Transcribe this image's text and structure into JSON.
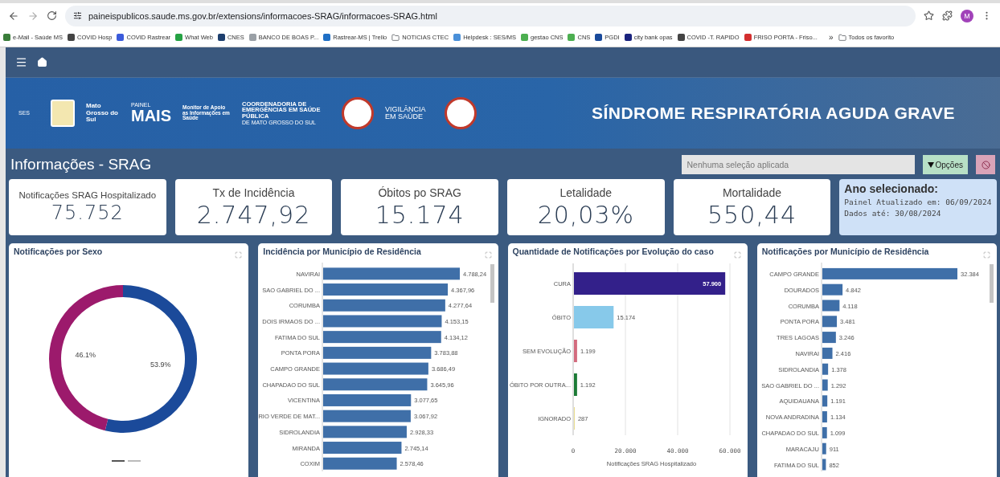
{
  "browser": {
    "url": "paineispublicos.saude.ms.gov.br/extensions/informacoes-SRAG/informacoes-SRAG.html",
    "avatar": "M",
    "bookmarks": [
      {
        "label": "e-Mail - Saúde MS",
        "kind": "site",
        "color": "#3a7d3a"
      },
      {
        "label": "COVID Hosp",
        "kind": "site",
        "color": "#444444"
      },
      {
        "label": "COVID Rastrear",
        "kind": "site",
        "color": "#3b5bdb"
      },
      {
        "label": "What Web",
        "kind": "site",
        "color": "#25a244"
      },
      {
        "label": "CNES",
        "kind": "site",
        "color": "#1d3f6e"
      },
      {
        "label": "BANCO DE BOAS P...",
        "kind": "site",
        "color": "#9aa0a6"
      },
      {
        "label": "Rastrear-MS | Trello",
        "kind": "site",
        "color": "#1f6fc5"
      },
      {
        "label": "NOTICIAS CTEC",
        "kind": "folder"
      },
      {
        "label": "Helpdesk : SES/MS",
        "kind": "site",
        "color": "#4a90d9"
      },
      {
        "label": "gestao CNS",
        "kind": "site",
        "color": "#4caf50"
      },
      {
        "label": "CNS",
        "kind": "site",
        "color": "#4caf50"
      },
      {
        "label": "PGDI",
        "kind": "site",
        "color": "#1a4a9b"
      },
      {
        "label": "city bank opas",
        "kind": "site",
        "color": "#1a237e"
      },
      {
        "label": "COVID -T. RAPIDO",
        "kind": "site",
        "color": "#444444"
      },
      {
        "label": "FRISO PORTA - Friso...",
        "kind": "site",
        "color": "#d32f2f"
      }
    ],
    "more": "»",
    "all_bookmarks": "Todos os favorito"
  },
  "banner": {
    "ses": "SES",
    "state": "Mato Grosso do Sul",
    "panel_small": "PAINEL",
    "panel_name": "MAIS",
    "monitor": "Monitor de Apoio as Informações em Saúde",
    "coord": "COORDENADORIA DE EMERGÊNCIAS EM SAÚDE PÚBLICA",
    "coord_sub": "DE MATO GROSSO DO SUL",
    "vigilancia": "VIGILÂNCIA EM SAÚDE",
    "title": "SÍNDROME RESPIRATÓRIA AGUDA GRAVE"
  },
  "page_title": "Informações - SRAG",
  "selection": {
    "placeholder": "Nenhuma seleção aplicada"
  },
  "options_button": "Opções",
  "kpis": [
    {
      "label": "Notificações SRAG Hospitalizado",
      "value": "75.752"
    },
    {
      "label": "Tx de Incidência",
      "value": "2.747,92"
    },
    {
      "label": "Óbitos po SRAG",
      "value": "15.174"
    },
    {
      "label": "Letalidade",
      "value": "20,03%"
    },
    {
      "label": "Mortalidade",
      "value": "550,44"
    }
  ],
  "year_card": {
    "title": "Ano selecionado:",
    "updated": "Painel Atualizado em: 06/09/2024",
    "data_until": "Dados até: 30/08/2024"
  },
  "charts": [
    {
      "title": "Notificações por Sexo",
      "chart_data": {
        "type": "donut",
        "values": [
          46.1,
          53.9
        ],
        "colors": [
          "#9c1a6c",
          "#1b4a9a"
        ],
        "value_labels": [
          "46.1%",
          "53.9%"
        ]
      }
    },
    {
      "title": "Incidência por Município de Residência",
      "chart_data": {
        "type": "bar",
        "orientation": "horizontal",
        "categories": [
          "NAVIRAI",
          "SAO GABRIEL DO ...",
          "CORUMBA",
          "DOIS IRMAOS DO ...",
          "FATIMA DO SUL",
          "PONTA PORA",
          "CAMPO GRANDE",
          "CHAPADAO DO SUL",
          "VICENTINA",
          "RIO VERDE DE MAT...",
          "SIDROLANDIA",
          "MIRANDA",
          "COXIM"
        ],
        "values": [
          4788.24,
          4367.96,
          4277.64,
          4153.15,
          4134.12,
          3783.88,
          3686.49,
          3645.96,
          3077.65,
          3067.92,
          2928.33,
          2745.14,
          2578.46
        ],
        "value_labels": [
          "4.788,24",
          "4.367,96",
          "4.277,64",
          "4.153,15",
          "4.134,12",
          "3.783,88",
          "3.686,49",
          "3.645,96",
          "3.077,65",
          "3.067,92",
          "2.928,33",
          "2.745,14",
          "2.578,46"
        ]
      }
    },
    {
      "title": "Quantidade de Notificações por Evolução do caso",
      "chart_data": {
        "type": "bar",
        "orientation": "horizontal",
        "xlabel": "Notificações SRAG Hospitalizado",
        "categories": [
          "CURA",
          "ÓBITO",
          "SEM EVOLUÇÃO",
          "ÓBITO POR OUTRA...",
          "IGNORADO"
        ],
        "values": [
          57900,
          15174,
          1199,
          1192,
          287
        ],
        "value_labels": [
          "57.900",
          "15.174",
          "1.199",
          "1.192",
          "287"
        ],
        "colors": [
          "#33208a",
          "#87c9ea",
          "#d36b7e",
          "#1c7a36",
          "#e8dc86"
        ],
        "xlim": [
          0,
          60000
        ],
        "xticks": [
          {
            "value": 0,
            "label": "0"
          },
          {
            "value": 20000,
            "label": "20.000"
          },
          {
            "value": 40000,
            "label": "40.000"
          },
          {
            "value": 60000,
            "label": "60.000"
          }
        ]
      }
    },
    {
      "title": "Notificações por Município de Residência",
      "chart_data": {
        "type": "bar",
        "orientation": "horizontal",
        "categories": [
          "CAMPO GRANDE",
          "DOURADOS",
          "CORUMBA",
          "PONTA PORA",
          "TRES LAGOAS",
          "NAVIRAI",
          "SIDROLANDIA",
          "SAO GABRIEL DO ...",
          "AQUIDAUANA",
          "NOVA ANDRADINA",
          "CHAPADAO DO SUL",
          "MARACAJU",
          "FATIMA DO SUL"
        ],
        "values": [
          32384,
          4842,
          4118,
          3481,
          3246,
          2416,
          1378,
          1292,
          1191,
          1134,
          1099,
          911,
          852
        ],
        "value_labels": [
          "32.384",
          "4.842",
          "4.118",
          "3.481",
          "3.246",
          "2.416",
          "1.378",
          "1.292",
          "1.191",
          "1.134",
          "1.099",
          "911",
          "852"
        ]
      }
    }
  ]
}
